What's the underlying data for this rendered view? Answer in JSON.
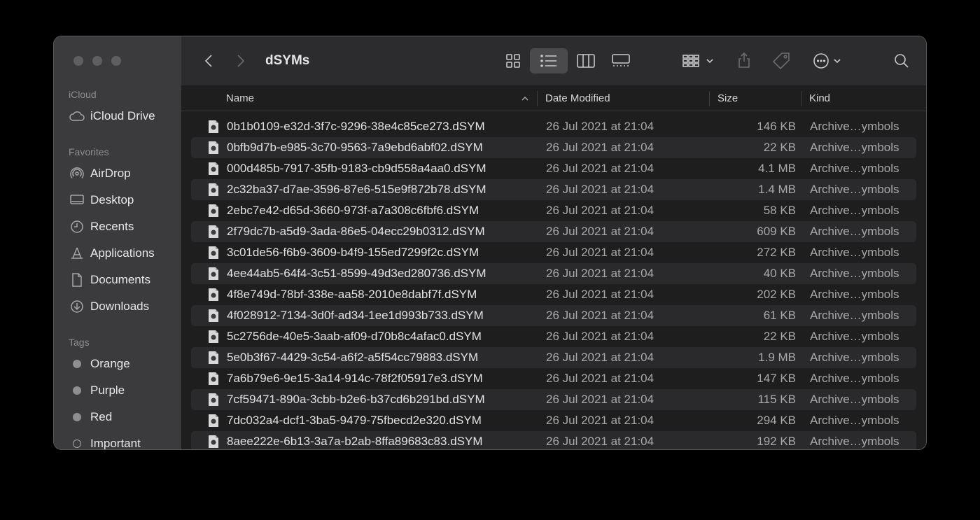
{
  "sidebar": {
    "icloud_title": "iCloud",
    "icloud_items": [
      {
        "label": "iCloud Drive",
        "icon": "cloud-icon"
      }
    ],
    "favorites_title": "Favorites",
    "favorites": [
      {
        "label": "AirDrop",
        "icon": "airdrop-icon"
      },
      {
        "label": "Desktop",
        "icon": "desktop-icon"
      },
      {
        "label": "Recents",
        "icon": "clock-icon"
      },
      {
        "label": "Applications",
        "icon": "applications-icon"
      },
      {
        "label": "Documents",
        "icon": "document-icon"
      },
      {
        "label": "Downloads",
        "icon": "download-icon"
      }
    ],
    "tags_title": "Tags",
    "tags": [
      {
        "label": "Orange"
      },
      {
        "label": "Purple"
      },
      {
        "label": "Red"
      },
      {
        "label": "Important"
      }
    ]
  },
  "toolbar": {
    "title": "dSYMs",
    "active_view": "list"
  },
  "columns": {
    "name": "Name",
    "date": "Date Modified",
    "size": "Size",
    "kind": "Kind"
  },
  "files": [
    {
      "name": "0b1b0109-e32d-3f7c-9296-38e4c85ce273.dSYM",
      "date": "26 Jul 2021 at 21:04",
      "size": "146 KB",
      "kind": "Archive…ymbols"
    },
    {
      "name": "0bfb9d7b-e985-3c70-9563-7a9ebd6abf02.dSYM",
      "date": "26 Jul 2021 at 21:04",
      "size": "22 KB",
      "kind": "Archive…ymbols"
    },
    {
      "name": "000d485b-7917-35fb-9183-cb9d558a4aa0.dSYM",
      "date": "26 Jul 2021 at 21:04",
      "size": "4.1 MB",
      "kind": "Archive…ymbols"
    },
    {
      "name": "2c32ba37-d7ae-3596-87e6-515e9f872b78.dSYM",
      "date": "26 Jul 2021 at 21:04",
      "size": "1.4 MB",
      "kind": "Archive…ymbols"
    },
    {
      "name": "2ebc7e42-d65d-3660-973f-a7a308c6fbf6.dSYM",
      "date": "26 Jul 2021 at 21:04",
      "size": "58 KB",
      "kind": "Archive…ymbols"
    },
    {
      "name": "2f79dc7b-a5d9-3ada-86e5-04ecc29b0312.dSYM",
      "date": "26 Jul 2021 at 21:04",
      "size": "609 KB",
      "kind": "Archive…ymbols"
    },
    {
      "name": "3c01de56-f6b9-3609-b4f9-155ed7299f2c.dSYM",
      "date": "26 Jul 2021 at 21:04",
      "size": "272 KB",
      "kind": "Archive…ymbols"
    },
    {
      "name": "4ee44ab5-64f4-3c51-8599-49d3ed280736.dSYM",
      "date": "26 Jul 2021 at 21:04",
      "size": "40 KB",
      "kind": "Archive…ymbols"
    },
    {
      "name": "4f8e749d-78bf-338e-aa58-2010e8dabf7f.dSYM",
      "date": "26 Jul 2021 at 21:04",
      "size": "202 KB",
      "kind": "Archive…ymbols"
    },
    {
      "name": "4f028912-7134-3d0f-ad34-1ee1d993b733.dSYM",
      "date": "26 Jul 2021 at 21:04",
      "size": "61 KB",
      "kind": "Archive…ymbols"
    },
    {
      "name": "5c2756de-40e5-3aab-af09-d70b8c4afac0.dSYM",
      "date": "26 Jul 2021 at 21:04",
      "size": "22 KB",
      "kind": "Archive…ymbols"
    },
    {
      "name": "5e0b3f67-4429-3c54-a6f2-a5f54cc79883.dSYM",
      "date": "26 Jul 2021 at 21:04",
      "size": "1.9 MB",
      "kind": "Archive…ymbols"
    },
    {
      "name": "7a6b79e6-9e15-3a14-914c-78f2f05917e3.dSYM",
      "date": "26 Jul 2021 at 21:04",
      "size": "147 KB",
      "kind": "Archive…ymbols"
    },
    {
      "name": "7cf59471-890a-3cbb-b2e6-b37cd6b291bd.dSYM",
      "date": "26 Jul 2021 at 21:04",
      "size": "115 KB",
      "kind": "Archive…ymbols"
    },
    {
      "name": "7dc032a4-dcf1-3ba5-9479-75fbecd2e320.dSYM",
      "date": "26 Jul 2021 at 21:04",
      "size": "294 KB",
      "kind": "Archive…ymbols"
    },
    {
      "name": "8aee222e-6b13-3a7a-b2ab-8ffa89683c83.dSYM",
      "date": "26 Jul 2021 at 21:04",
      "size": "192 KB",
      "kind": "Archive…ymbols"
    }
  ]
}
